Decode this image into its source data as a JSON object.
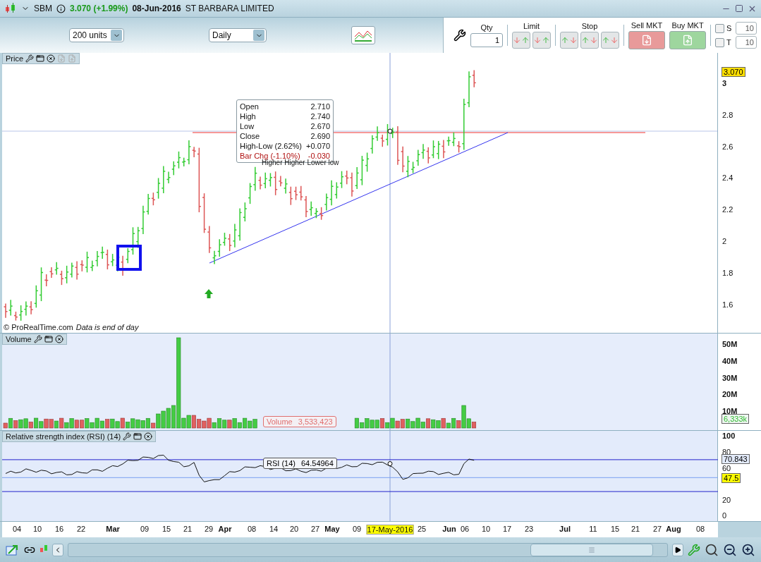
{
  "header": {
    "symbol": "SBM",
    "price_change": "3.070 (+1.99%)",
    "date": "08-Jun-2016",
    "name": "ST BARBARA LIMITED"
  },
  "toolbar": {
    "units": "200 units",
    "period": "Daily"
  },
  "order_panel": {
    "qty_label": "Qty",
    "qty": "1",
    "limit_label": "Limit",
    "stop_label": "Stop",
    "sell_label": "Sell MKT",
    "buy_label": "Buy MKT",
    "options": [
      {
        "label": "S",
        "checked": false,
        "value": "10"
      },
      {
        "label": "T",
        "checked": false,
        "value": "10"
      }
    ]
  },
  "price_pane": {
    "title": "Price",
    "axis": [
      "3",
      "2.8",
      "2.6",
      "2.4",
      "2.2",
      "2",
      "1.8",
      "1.6"
    ],
    "last_price": "3.070",
    "tooltip": [
      {
        "label": "Open",
        "value": "2.710",
        "kind": "normal"
      },
      {
        "label": "High",
        "value": "2.740",
        "kind": "normal"
      },
      {
        "label": "Low",
        "value": "2.670",
        "kind": "normal"
      },
      {
        "label": "Close",
        "value": "2.690",
        "kind": "normal"
      },
      {
        "label": "High-Low (2.62%)",
        "value": "+0.070",
        "kind": "normal"
      },
      {
        "label": "Bar Chg (-1.10%)",
        "value": "-0.030",
        "kind": "change"
      }
    ],
    "annotation": "Higher Higher Lower low",
    "source": "© ProRealTime.com",
    "note": "Data is end of day"
  },
  "volume_pane": {
    "title": "Volume",
    "axis": [
      "50M",
      "40M",
      "30M",
      "20M",
      "10M"
    ],
    "last_value": "6,333k",
    "cursor_label": "Volume",
    "cursor_value": "3,533,423"
  },
  "rsi_pane": {
    "title": "Relative strength index (RSI) (14)",
    "axis": [
      "100",
      "80",
      "60",
      "20",
      "0"
    ],
    "last_value": "70.843",
    "level_value": "47.5",
    "cursor_label": "RSI (14)",
    "cursor_value": "64.54964"
  },
  "x_axis": [
    {
      "label": "04",
      "kind": "day"
    },
    {
      "label": "10",
      "kind": "day"
    },
    {
      "label": "16",
      "kind": "day"
    },
    {
      "label": "22",
      "kind": "day"
    },
    {
      "label": "Mar",
      "kind": "month"
    },
    {
      "label": "09",
      "kind": "day"
    },
    {
      "label": "15",
      "kind": "day"
    },
    {
      "label": "21",
      "kind": "day"
    },
    {
      "label": "29",
      "kind": "day"
    },
    {
      "label": "Apr",
      "kind": "month"
    },
    {
      "label": "08",
      "kind": "day"
    },
    {
      "label": "14",
      "kind": "day"
    },
    {
      "label": "20",
      "kind": "day"
    },
    {
      "label": "27",
      "kind": "day"
    },
    {
      "label": "May",
      "kind": "month"
    },
    {
      "label": "09",
      "kind": "day"
    },
    {
      "label": "17-May-2016",
      "kind": "cursor"
    },
    {
      "label": "25",
      "kind": "day"
    },
    {
      "label": "Jun",
      "kind": "month"
    },
    {
      "label": "06",
      "kind": "day"
    },
    {
      "label": "10",
      "kind": "day"
    },
    {
      "label": "17",
      "kind": "day"
    },
    {
      "label": "23",
      "kind": "day"
    },
    {
      "label": "Jul",
      "kind": "month"
    },
    {
      "label": "11",
      "kind": "day"
    },
    {
      "label": "15",
      "kind": "day"
    },
    {
      "label": "21",
      "kind": "day"
    },
    {
      "label": "27",
      "kind": "day"
    },
    {
      "label": "Aug",
      "kind": "month"
    },
    {
      "label": "08",
      "kind": "day"
    }
  ]
}
